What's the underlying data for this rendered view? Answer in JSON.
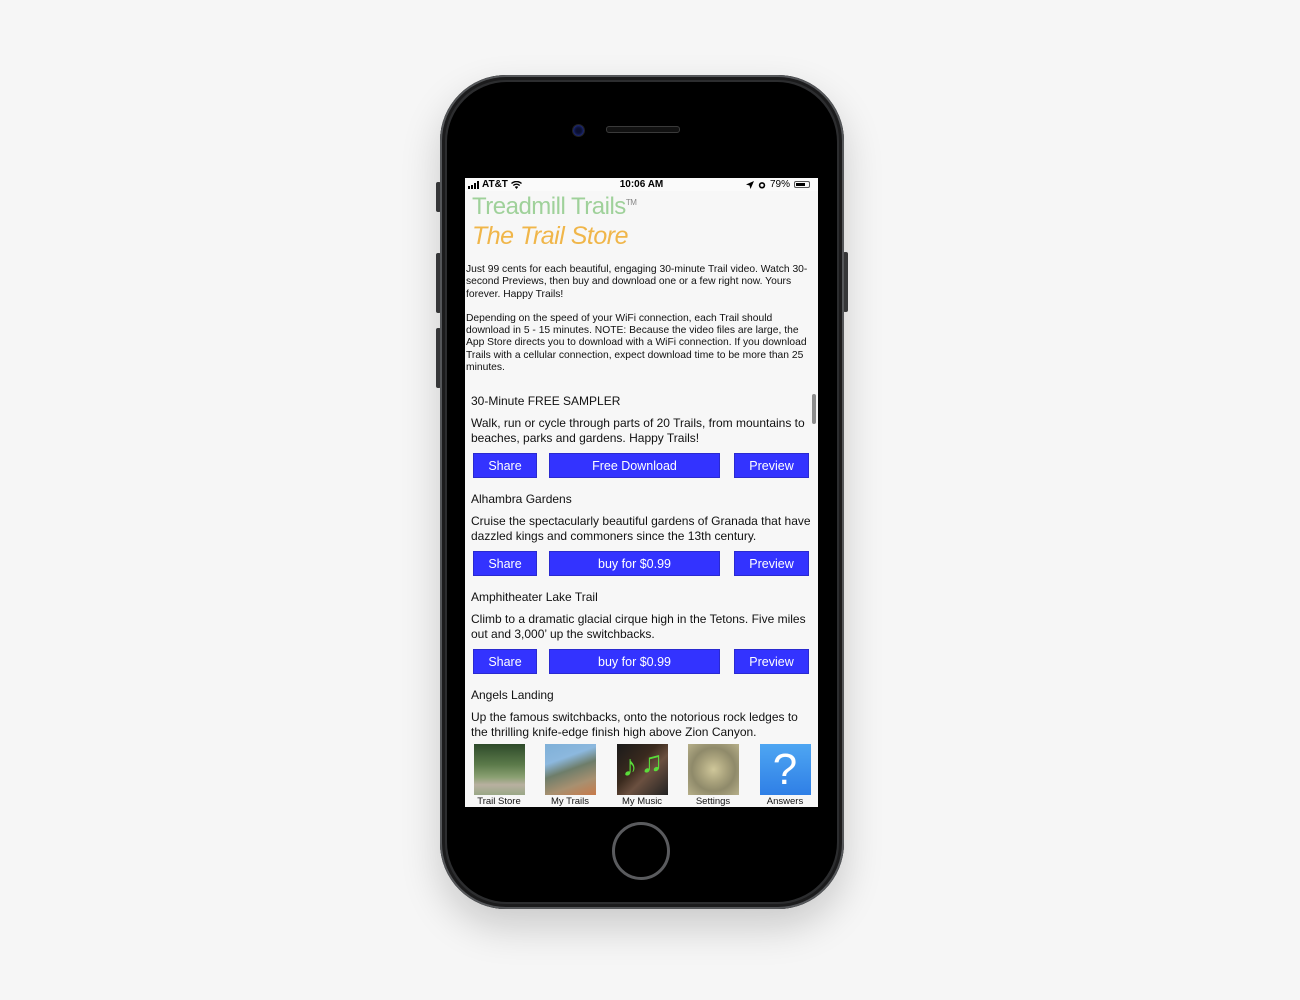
{
  "status_bar": {
    "carrier": "AT&T",
    "time": "10:06 AM",
    "battery_percent": "79%",
    "battery_level": 0.79,
    "icons": [
      "signal-icon",
      "wifi-icon",
      "location-icon",
      "alarm-icon",
      "battery-icon"
    ]
  },
  "header": {
    "app_name": "Treadmill Trails",
    "trademark": "TM",
    "page_title": "The Trail Store"
  },
  "intro": {
    "paragraph1": "Just 99 cents for each beautiful, engaging 30-minute Trail video. Watch 30-second Previews, then buy and download one or a few right now. Yours forever. Happy Trails!",
    "paragraph2": "Depending on the speed of your WiFi connection, each Trail should download in 5 - 15 minutes. NOTE: Because the video files are large, the App Store directs you to download with a WiFi connection. If you download Trails with a cellular connection, expect download time to be more than 25 minutes."
  },
  "trails": [
    {
      "name": "30-Minute FREE SAMPLER",
      "description": "Walk, run or cycle through parts of 20 Trails, from mountains to beaches, parks and gardens. Happy Trails!",
      "share_label": "Share",
      "action_label": "Free Download",
      "preview_label": "Preview"
    },
    {
      "name": "Alhambra Gardens",
      "description": "Cruise the spectacularly beautiful gardens of Granada that have dazzled kings and commoners since the 13th century.",
      "share_label": "Share",
      "action_label": "buy for $0.99",
      "preview_label": "Preview"
    },
    {
      "name": "Amphitheater Lake Trail",
      "description": "Climb to a dramatic glacial cirque high in the Tetons. Five miles out and 3,000’ up the switchbacks.",
      "share_label": "Share",
      "action_label": "buy for $0.99",
      "preview_label": "Preview"
    },
    {
      "name": "Angels Landing",
      "description": "Up the famous switchbacks, onto the notorious rock ledges to the thrilling knife-edge finish high above Zion Canyon."
    }
  ],
  "tab_bar": [
    {
      "label": "Trail Store",
      "icon": "forest-path-icon"
    },
    {
      "label": "My Trails",
      "icon": "coastal-cliff-icon"
    },
    {
      "label": "My Music",
      "icon": "music-notes-icon"
    },
    {
      "label": "Settings",
      "icon": "gears-icon"
    },
    {
      "label": "Answers",
      "icon": "question-mark-icon",
      "glyph": "?"
    }
  ],
  "colors": {
    "button_bg": "#3333ff",
    "button_text": "#ffffff",
    "app_name": "#9fd19a",
    "page_title": "#f0b64a",
    "answers_icon": "#2f7fe6",
    "music_notes": "#5adc3a"
  }
}
